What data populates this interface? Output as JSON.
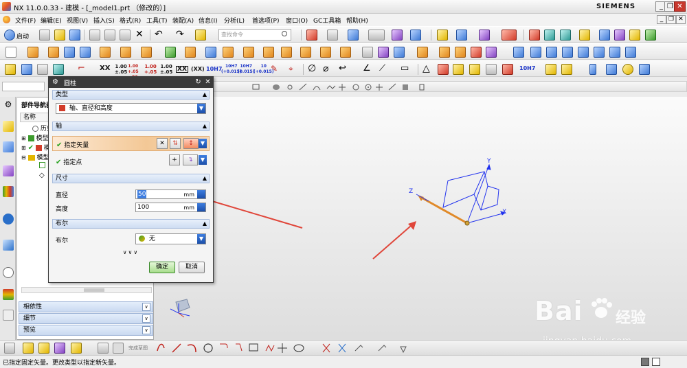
{
  "window": {
    "title": "NX 11.0.0.33 - 建模 - [_model1.prt （修改的）]",
    "brand": "SIEMENS",
    "controls": [
      "_",
      "❐",
      "✕"
    ]
  },
  "menu": {
    "items": [
      "文件(F)",
      "编辑(E)",
      "视图(V)",
      "插入(S)",
      "格式(R)",
      "工具(T)",
      "装配(A)",
      "信息(I)",
      "分析(L)",
      "首选项(P)",
      "窗口(O)",
      "GC工具箱",
      "帮助(H)"
    ],
    "mini_controls": [
      "_",
      "❐",
      "✕"
    ]
  },
  "toolbar": {
    "start_label": "启动",
    "search_placeholder": "查找命令",
    "row3_labels": [
      "XX",
      "1.00\n±.05",
      "1.00\n+.05\n-.02",
      "1.00\n+.05",
      "1.00\n±.05",
      "XX",
      "(XX)",
      "10H7",
      "10H7\n(+0.015)",
      "10H7\n(0.015)",
      "10\n(+0.015)",
      "10H7"
    ]
  },
  "navigator": {
    "title": "部件导航器",
    "column_header": "名称",
    "rows": [
      "历史",
      "模型",
      "模型",
      "模型",
      "",
      ""
    ],
    "sections": [
      "相依性",
      "细节",
      "预览"
    ]
  },
  "dialog": {
    "title": "圆柱",
    "type_group": "类型",
    "type_value": "轴、直径和高度",
    "axis_group": "轴",
    "specify_vector": "指定矢量",
    "specify_point": "指定点",
    "dims_group": "尺寸",
    "diameter_label": "直径",
    "diameter_value": "50",
    "height_label": "高度",
    "height_value": "100",
    "unit": "mm",
    "bool_group": "布尔",
    "bool_label": "布尔",
    "bool_value": "无",
    "more": "∨∨∨",
    "ok": "确定",
    "cancel": "取消"
  },
  "graphics": {
    "axis_labels": [
      "X",
      "Y",
      "Z"
    ]
  },
  "watermark": {
    "brand": "Bai",
    "cn": "经验",
    "url": "jingyan.baidu.com"
  },
  "bottom": {
    "sketch_label": "完成草图"
  },
  "status": {
    "message": "已指定固定矢量。更改类型以指定新矢量。"
  },
  "colors": {
    "accent_blue": "#3d7de0",
    "vector_orange": "#e08a2a",
    "arrow_red": "#e0463a",
    "axis_blue": "#2233ee"
  }
}
